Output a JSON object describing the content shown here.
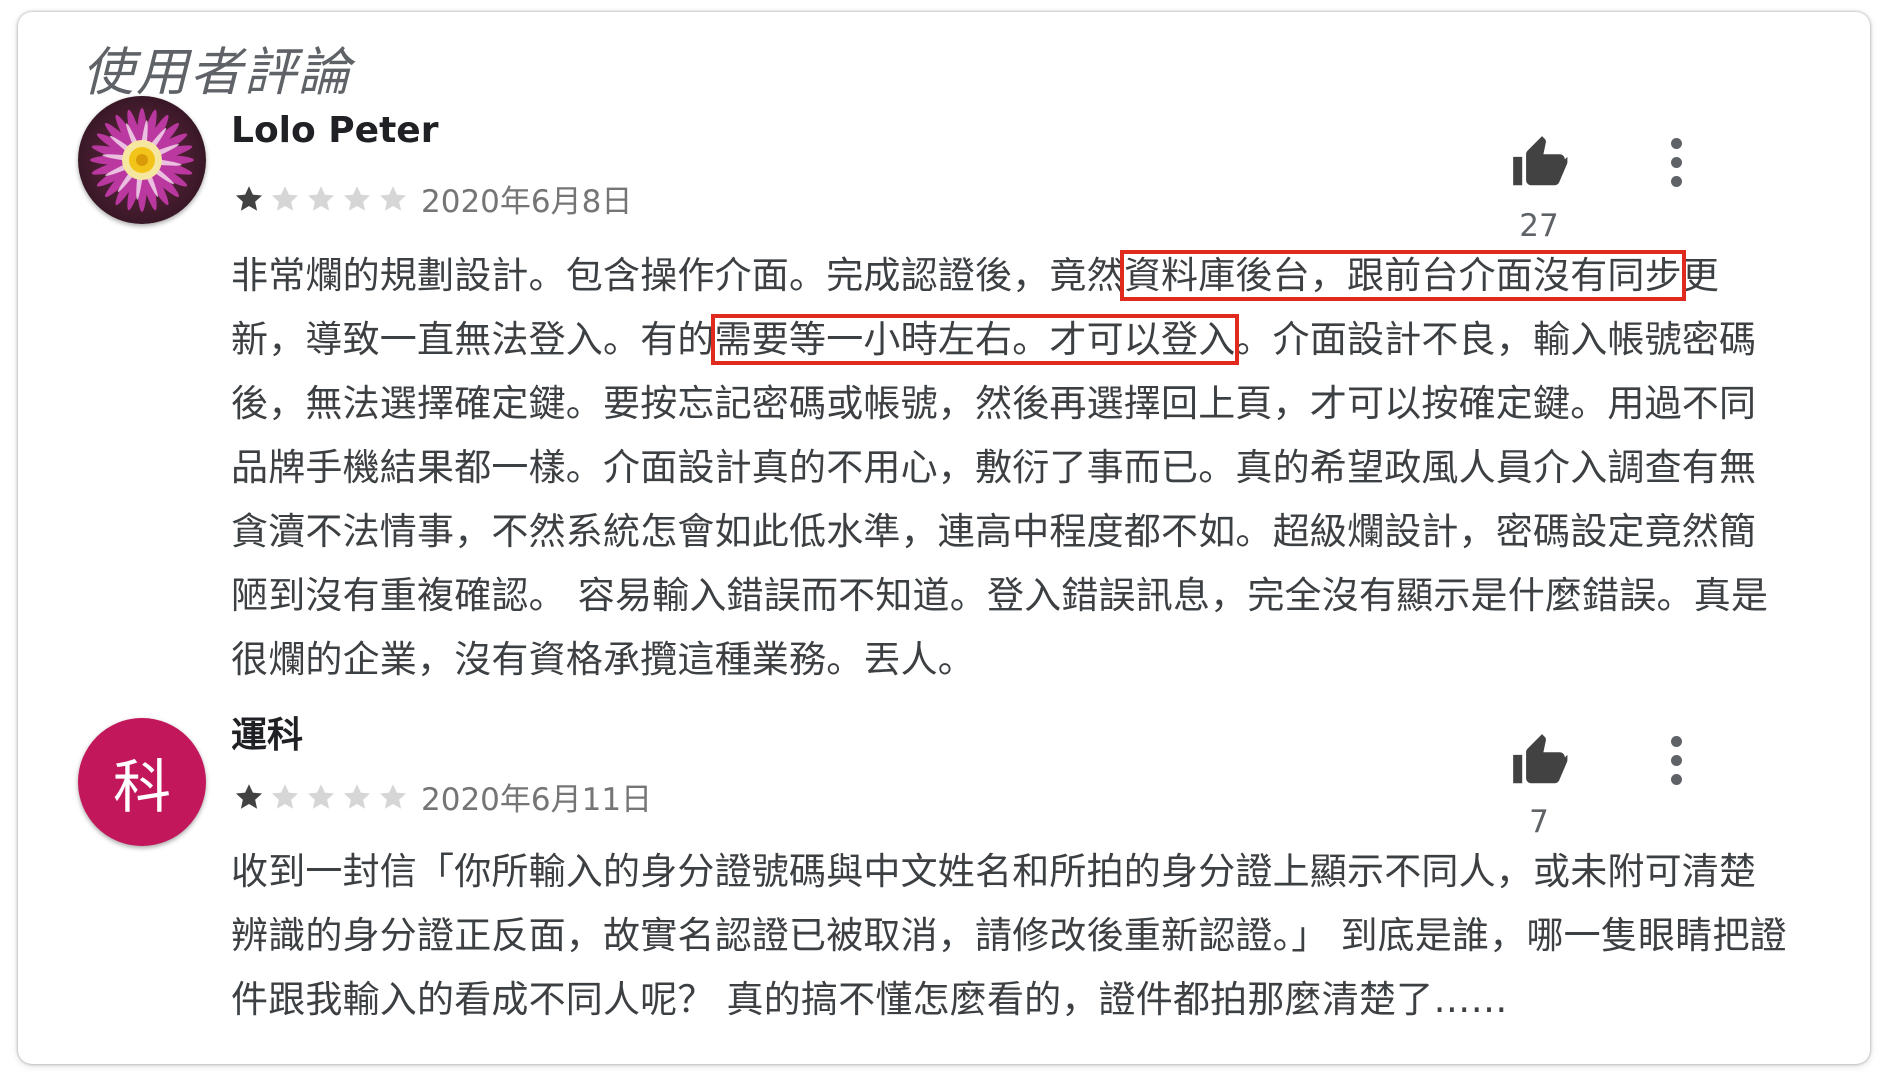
{
  "section": {
    "title": "使用者評論"
  },
  "reviews": [
    {
      "author": "Lolo Peter",
      "avatar": "flower-photo",
      "rating": 1,
      "max_rating": 5,
      "date": "2020年6月8日",
      "likes": "27",
      "text": {
        "p1": "非常爛的規劃設計。包含操作介面。完成認證後，竟然",
        "hl1": "資料庫後台，跟前台介面沒有同步",
        "p2": "更新，導致一直無法登入。有的",
        "hl2": "需要等一小時左右。才可以登入",
        "p3": "。介面設計不良，輸入帳號密碼後，無法選擇確定鍵。要按忘記密碼或帳號，然後再選擇回上頁，才可以按確定鍵。用過不同品牌手機結果都一樣。介面設計真的不用心，敷衍了事而已。真的希望政風人員介入調查有無貪瀆不法情事，不然系統怎會如此低水準，連高中程度都不如。超級爛設計，密碼設定竟然簡陋到沒有重複確認。 容易輸入錯誤而不知道。登入錯誤訊息，完全沒有顯示是什麼錯誤。真是很爛的企業，沒有資格承攬這種業務。丟人。"
      }
    },
    {
      "author": "運科",
      "avatar_letter": "科",
      "avatar_color": "#c2185b",
      "rating": 1,
      "max_rating": 5,
      "date": "2020年6月11日",
      "likes": "7",
      "text": "收到一封信「你所輸入的身分證號碼與中文姓名和所拍的身分證上顯示不同人，或未附可清楚辨識的身分證正反面，故實名認證已被取消，請修改後重新認證。」 到底是誰，哪一隻眼睛把證件跟我輸入的看成不同人呢？ 真的搞不懂怎麼看的，證件都拍那麼清楚了……"
    }
  ],
  "icons": {
    "like": "thumbs-up-icon",
    "more": "more-vertical-icon",
    "star": "star-icon"
  },
  "colors": {
    "highlight_box": "#e02a1e",
    "star_filled": "#424242",
    "star_empty": "#d6d6d6",
    "avatar_2": "#c2185b"
  }
}
